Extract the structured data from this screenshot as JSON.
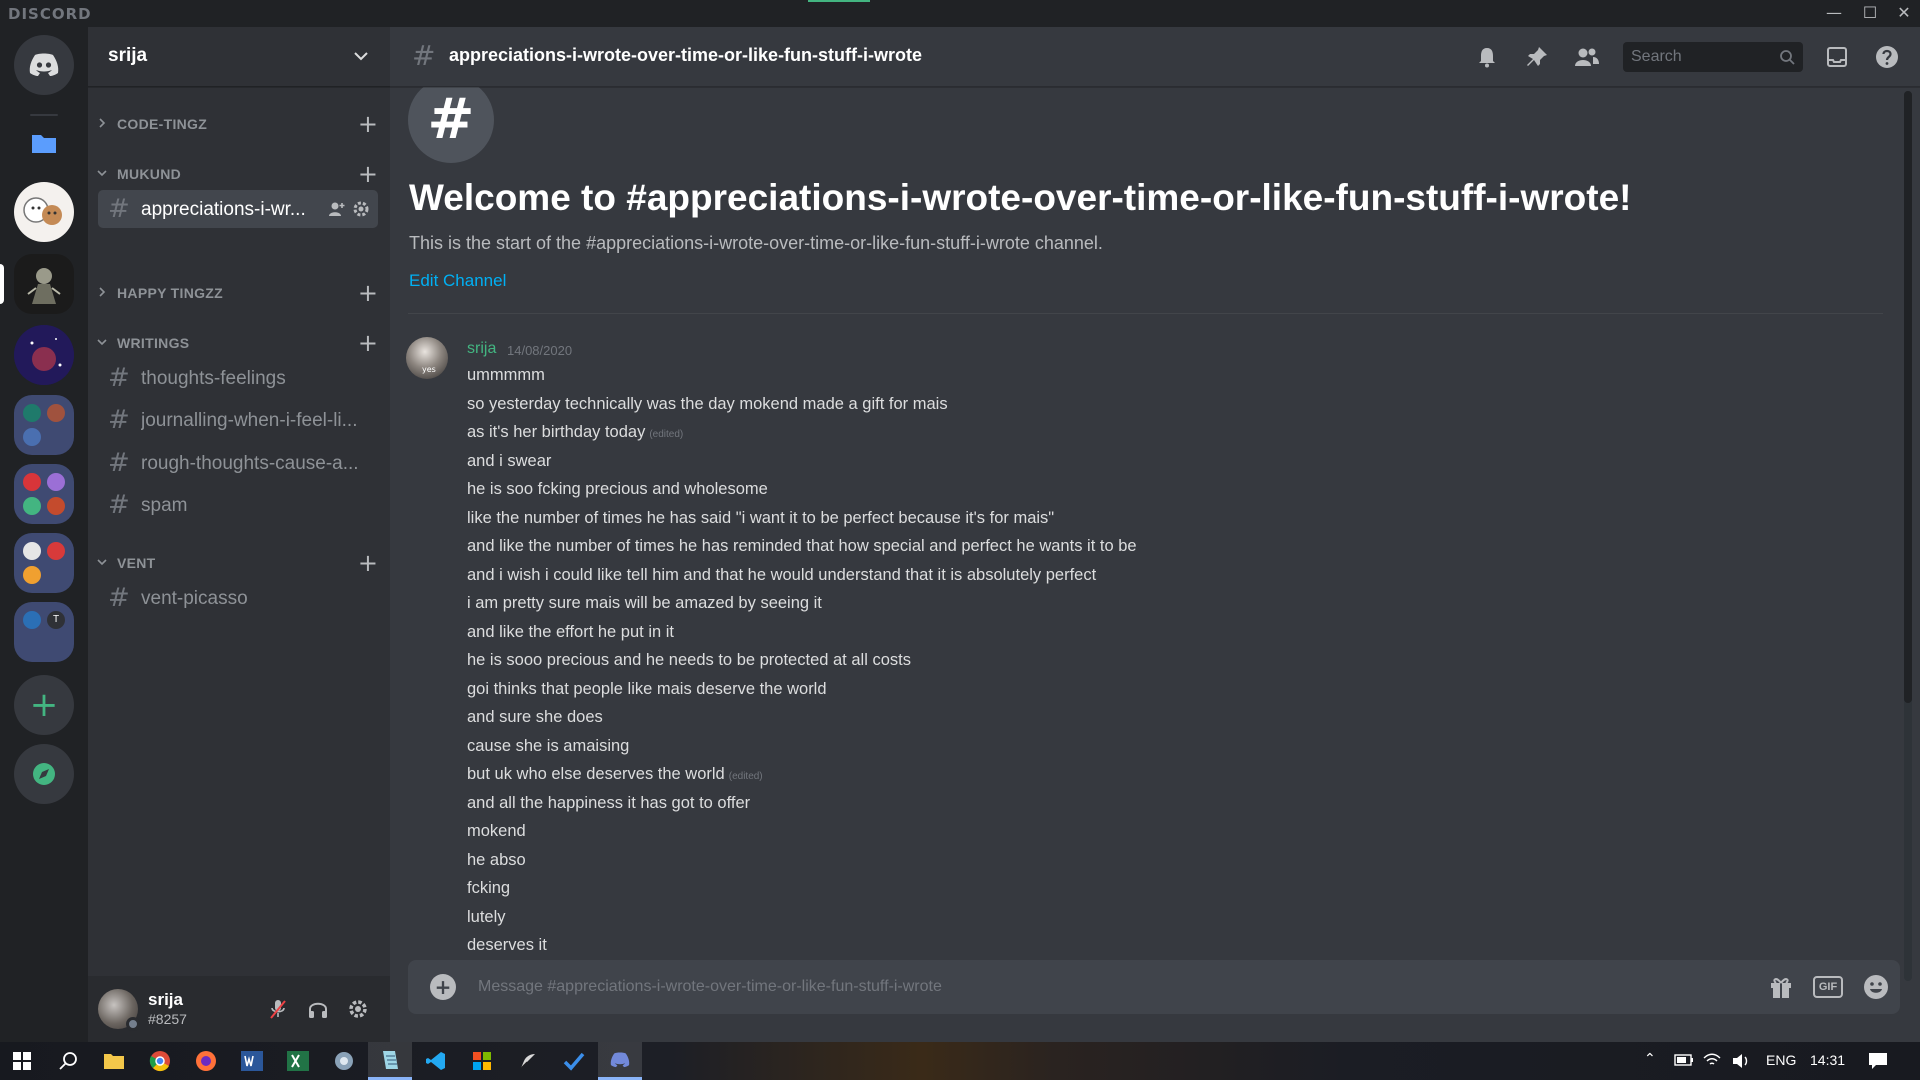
{
  "app": {
    "brand": "DISCORD"
  },
  "guild": {
    "name": "srija"
  },
  "sidebar": {
    "categories": [
      {
        "name": "CODE-TINGZ"
      },
      {
        "name": "MUKUND"
      },
      {
        "name": "HAPPY TINGZZ"
      },
      {
        "name": "WRITINGS"
      },
      {
        "name": "VENT"
      }
    ],
    "mukund_channels": [
      "appreciations-i-wr..."
    ],
    "writings_channels": [
      "thoughts-feelings",
      "journalling-when-i-feel-li...",
      "rough-thoughts-cause-a...",
      "spam"
    ],
    "vent_channels": [
      "vent-picasso"
    ]
  },
  "user": {
    "name": "srija",
    "tag": "#8257"
  },
  "channel": {
    "name": "appreciations-i-wrote-over-time-or-like-fun-stuff-i-wrote",
    "welcome_title": "Welcome to #appreciations-i-wrote-over-time-or-like-fun-stuff-i-wrote!",
    "welcome_sub": "This is the start of the #appreciations-i-wrote-over-time-or-like-fun-stuff-i-wrote channel.",
    "edit_label": "Edit Channel"
  },
  "search": {
    "placeholder": "Search"
  },
  "message": {
    "author": "srija",
    "timestamp": "14/08/2020",
    "avatar_text": "yes",
    "edited_label": "(edited)",
    "lines": [
      {
        "text": "ummmmm",
        "edited": false
      },
      {
        "text": "so yesterday technically was the day mokend made a gift for mais",
        "edited": false
      },
      {
        "text": "as it's her birthday today",
        "edited": true
      },
      {
        "text": "and i swear",
        "edited": false
      },
      {
        "text": "he is soo fcking precious and wholesome",
        "edited": false
      },
      {
        "text": "like the number of times he has said \"i want it to be perfect because it's for mais\"",
        "edited": false
      },
      {
        "text": "and like the number of times he has reminded that how special and perfect he wants it to be",
        "edited": false
      },
      {
        "text": "and i wish i could like tell him and that he would understand that it is absolutely perfect",
        "edited": false
      },
      {
        "text": "i am pretty sure mais will be amazed by seeing it",
        "edited": false
      },
      {
        "text": "and like the effort he put in it",
        "edited": false
      },
      {
        "text": "he is sooo precious and he needs to be protected at all costs",
        "edited": false
      },
      {
        "text": "goi thinks that people like mais deserve the world",
        "edited": false
      },
      {
        "text": "and sure she does",
        "edited": false
      },
      {
        "text": "cause she is amaising",
        "edited": false
      },
      {
        "text": "but uk who else deserves the world",
        "edited": true
      },
      {
        "text": "and all the happiness it has got to offer",
        "edited": false
      },
      {
        "text": "mokend",
        "edited": false
      },
      {
        "text": "he abso",
        "edited": false
      },
      {
        "text": "fcking",
        "edited": false
      },
      {
        "text": "lutely",
        "edited": false
      },
      {
        "text": "deserves it",
        "edited": false
      }
    ]
  },
  "composer": {
    "placeholder": "Message #appreciations-i-wrote-over-time-or-like-fun-stuff-i-wrote",
    "gif_label": "GIF"
  },
  "taskbar": {
    "lang": "ENG",
    "time": "14:31"
  },
  "colors": {
    "accent_green": "#43b581",
    "link": "#00b0f4",
    "background": "#36393f",
    "sidebar": "#2f3136",
    "rail": "#202225"
  }
}
